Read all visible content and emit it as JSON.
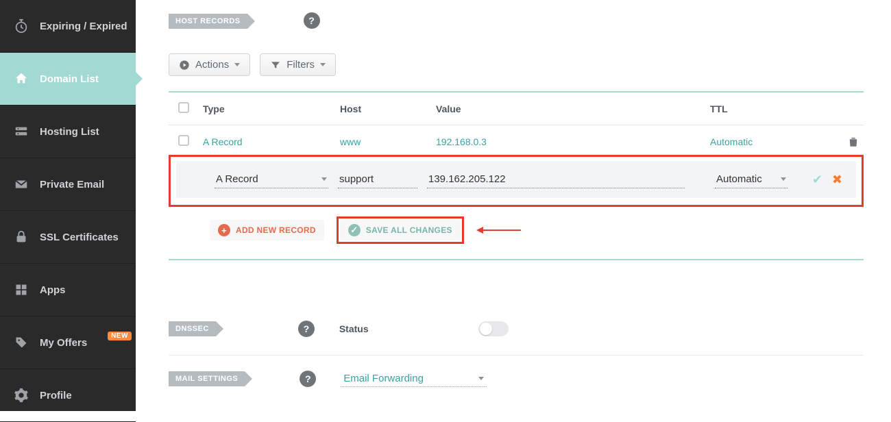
{
  "sidebar": {
    "items": [
      {
        "label": "Expiring / Expired"
      },
      {
        "label": "Domain List"
      },
      {
        "label": "Hosting List"
      },
      {
        "label": "Private Email"
      },
      {
        "label": "SSL Certificates"
      },
      {
        "label": "Apps"
      },
      {
        "label": "My Offers",
        "badge": "NEW"
      },
      {
        "label": "Profile"
      }
    ]
  },
  "sections": {
    "host_records": "HOST RECORDS",
    "dnssec": "DNSSEC",
    "mail": "MAIL SETTINGS"
  },
  "toolbar": {
    "actions": "Actions",
    "filters": "Filters"
  },
  "table": {
    "headers": {
      "type": "Type",
      "host": "Host",
      "value": "Value",
      "ttl": "TTL"
    },
    "rows": [
      {
        "type": "A Record",
        "host": "www",
        "value": "192.168.0.3",
        "ttl": "Automatic"
      }
    ],
    "edit": {
      "type": "A Record",
      "host": "support",
      "value": "139.162.205.122",
      "ttl": "Automatic"
    }
  },
  "buttons": {
    "add": "ADD NEW RECORD",
    "save": "SAVE ALL CHANGES"
  },
  "dnssec": {
    "status_label": "Status"
  },
  "mail": {
    "forwarding": "Email Forwarding"
  }
}
